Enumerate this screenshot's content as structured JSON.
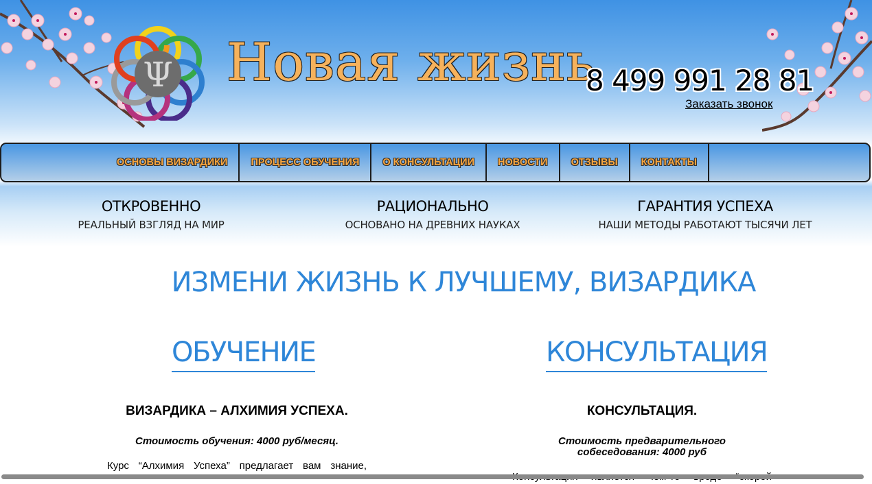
{
  "header": {
    "site_title": "Новая жизнь",
    "phone": "8 499 991 28 81",
    "callback_link": "Заказать звонок",
    "logo_icon": "psi-flower-logo-icon",
    "decoration_icon": "cherry-blossom-icon"
  },
  "nav": {
    "items": [
      {
        "label": "Основы визардики"
      },
      {
        "label": "Процесс обучения"
      },
      {
        "label": "О консультации"
      },
      {
        "label": "Новости"
      },
      {
        "label": "Отзывы"
      },
      {
        "label": "Контакты"
      }
    ]
  },
  "features": [
    {
      "title": "ОТКРОВЕННО",
      "subtitle": "РЕАЛЬНЫЙ ВЗГЛЯД НА МИР"
    },
    {
      "title": "РАЦИОНАЛЬНО",
      "subtitle": "ОСНОВАНО НА ДРЕВНИХ НАУКАХ"
    },
    {
      "title": "ГАРАНТИЯ УСПЕХА",
      "subtitle": "НАШИ МЕТОДЫ РАБОТАЮТ ТЫСЯЧИ ЛЕТ"
    }
  ],
  "main": {
    "heading": "ИЗМЕНИ ЖИЗНЬ К ЛУЧШЕМУ, ВИЗАРДИКА",
    "columns": [
      {
        "heading": "ОБУЧЕНИЕ",
        "subtitle": "ВИЗАРДИКА – АЛХИМИЯ УСПЕХА.",
        "price": "Стоимость обучения: 4000 руб/месяц.",
        "body": "Курс “Алхимия Успеха” предлагает вам знание,"
      },
      {
        "heading": "КОНСУЛЬТАЦИЯ",
        "subtitle": "КОНСУЛЬТАЦИЯ.",
        "price": "Стоимость предварительного собеседования: 4000 руб",
        "body": "Консультация является чем-то вроде “скорой"
      }
    ]
  },
  "colors": {
    "accent_blue": "#2e86d8",
    "title_orange": "#f6b25c",
    "nav_text_orange": "#f7a53e"
  }
}
